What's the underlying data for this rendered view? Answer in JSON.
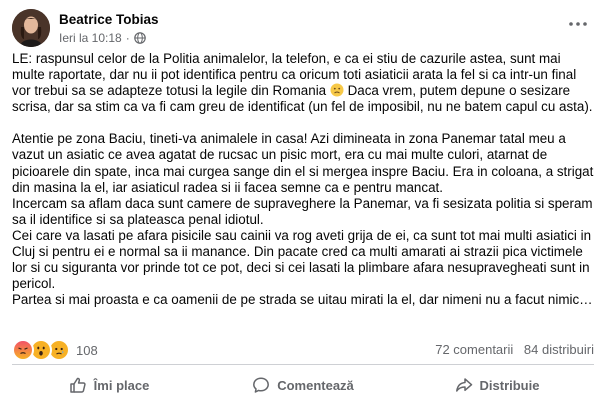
{
  "post": {
    "author": "Beatrice Tobias",
    "timestamp": "Ieri la 10:18",
    "separator": "·",
    "privacy_icon": "globe-icon",
    "paragraphs": [
      {
        "id": "p1",
        "before_emoji": "LE: raspunsul celor de la Politia animalelor, la telefon, e ca ei stiu de cazurile astea, sunt mai multe raportate, dar nu ii pot identifica pentru ca oricum toti asiaticii arata la fel si ca intr-un final vor trebui sa se adapteze totusi la legile din Romania",
        "emoji": "frowning-face-emoji",
        "after_emoji": " Daca vrem, putem depune o sesizare scrisa, dar sa stim ca va fi cam greu de identificat (un fel de imposibil, nu ne batem capul cu asta)."
      }
    ],
    "lines": [
      "Atentie pe zona Baciu, tineti-va animalele in casa! Azi dimineata in zona Panemar tatal meu a vazut un asiatic ce avea agatat de rucsac un pisic mort, era cu mai multe culori, atarnat de picioarele din spate, inca mai curgea sange din el si mergea inspre Baciu. Era in coloana, a strigat din masina la el, iar asiaticul radea si ii facea semne ca e pentru mancat.",
      "Incercam sa aflam daca sunt camere de supraveghere la Panemar, va fi sesizata politia si speram sa il identifice si sa plateasca penal idiotul.",
      "Cei care va lasati pe afara pisicile sau cainii va rog aveti grija de ei, ca sunt tot mai multi asiatici in Cluj si pentru ei e normal sa ii manance. Din pacate cred ca multi amarati ai strazii pica victimele lor si cu siguranta vor prinde tot ce pot, deci si cei lasati la plimbare afara nesupravegheati sunt in pericol.",
      "Partea si mai proasta e ca oamenii de pe strada se uitau mirati la el, dar nimeni nu a facut nimic…"
    ]
  },
  "reactions": {
    "icons": [
      "angry-react-icon",
      "wow-react-icon",
      "sad-react-icon"
    ],
    "count": "108",
    "comments": "72 comentarii",
    "shares": "84 distribuiri"
  },
  "actions": {
    "like": "Îmi place",
    "comment": "Comentează",
    "share": "Distribuie"
  },
  "colors": {
    "secondary_text": "#65676b",
    "primary_text": "#050505",
    "divider": "#ced0d4",
    "angry": "#e9710f",
    "wow_sad": "#f7b125"
  }
}
